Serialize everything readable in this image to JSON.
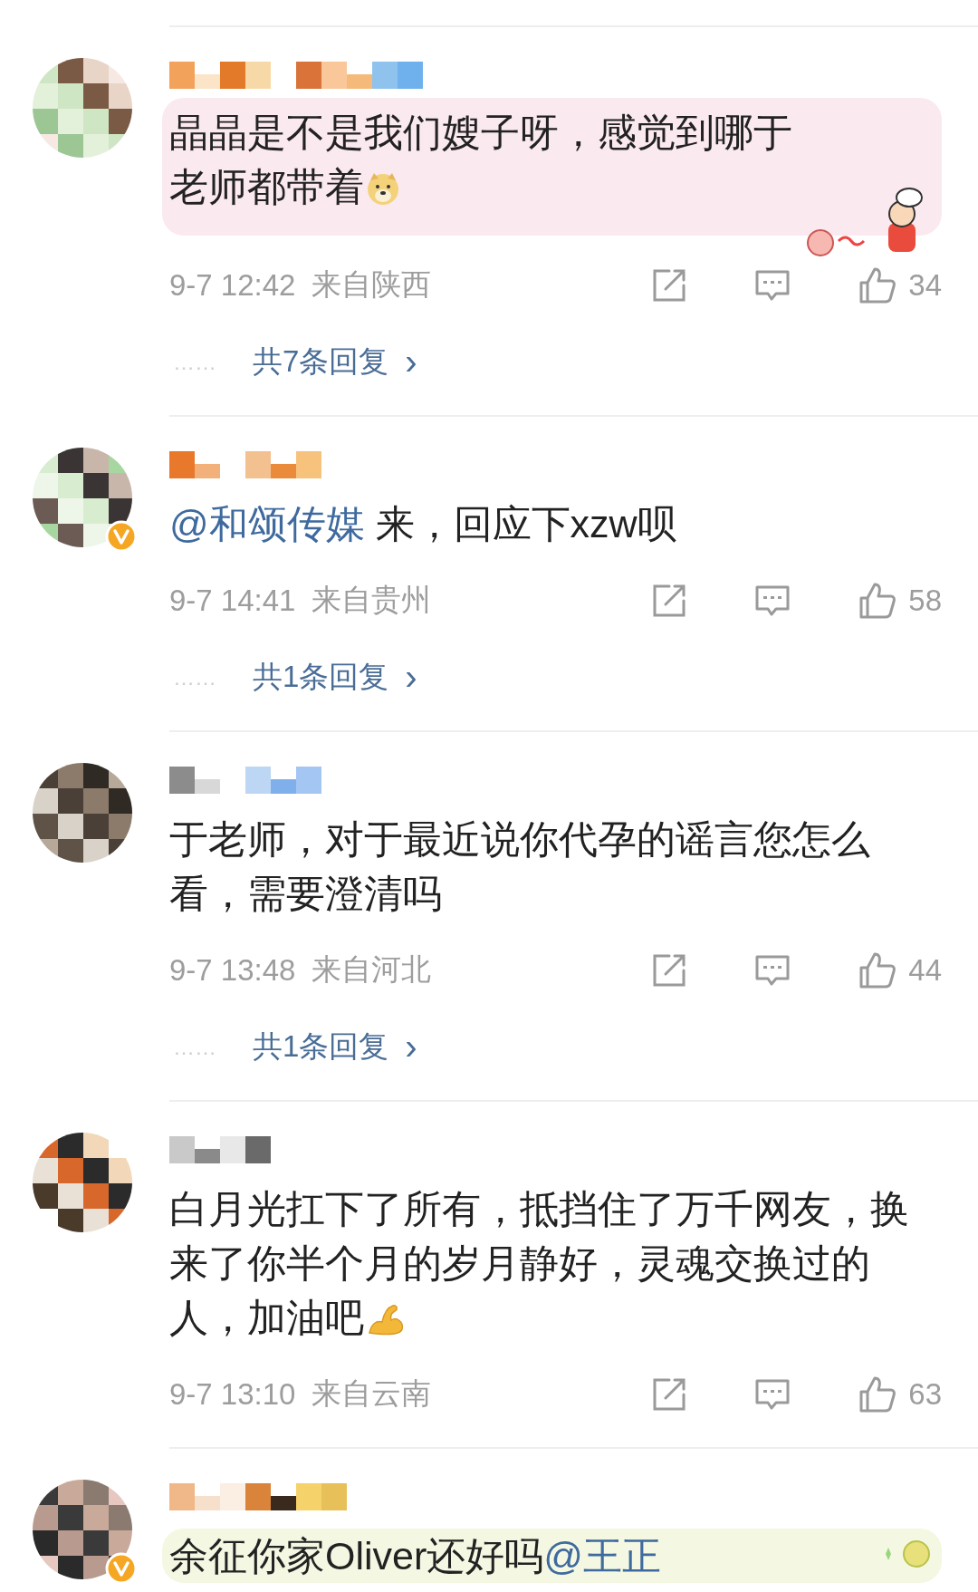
{
  "comments": [
    {
      "verified": false,
      "color": "#fbe9f0",
      "sticker": {
        "kind": "cartoon"
      },
      "segments": [
        {
          "kind": "plain",
          "text": "晶晶是不是我们嫂子呀，感觉到哪于老师都带着"
        },
        {
          "kind": "doge"
        }
      ],
      "date": "9-7 12:42",
      "location": "来自陕西",
      "likes": "34",
      "more": "……",
      "replies": "共7条回复",
      "chevron": "›"
    },
    {
      "verified": true,
      "segments": [
        {
          "kind": "mention",
          "text": "@和颂传媒"
        },
        {
          "kind": "plain",
          "text": " 来，回应下xzw呗"
        }
      ],
      "date": "9-7 14:41",
      "location": "来自贵州",
      "likes": "58",
      "more": "……",
      "replies": "共1条回复",
      "chevron": "›"
    },
    {
      "verified": false,
      "segments": [
        {
          "kind": "plain",
          "text": "于老师，对于最近说你代孕的谣言您怎么看，需要澄清吗"
        }
      ],
      "date": "9-7 13:48",
      "location": "来自河北",
      "likes": "44",
      "more": "……",
      "replies": "共1条回复",
      "chevron": "›"
    },
    {
      "verified": false,
      "segments": [
        {
          "kind": "plain",
          "text": "白月光扛下了所有，抵挡住了万千网友，换来了你半个月的岁月静好，灵魂交换过的人，加油吧"
        },
        {
          "kind": "flex"
        }
      ],
      "date": "9-7 13:10",
      "location": "来自云南",
      "likes": "63"
    },
    {
      "verified": true,
      "color": "#f4f8e2",
      "sticker": {
        "kind": "sparkle"
      },
      "segments": [
        {
          "kind": "plain",
          "text": "余征你家Oliver还好吗"
        },
        {
          "kind": "mention",
          "text": "@王正"
        }
      ]
    }
  ]
}
